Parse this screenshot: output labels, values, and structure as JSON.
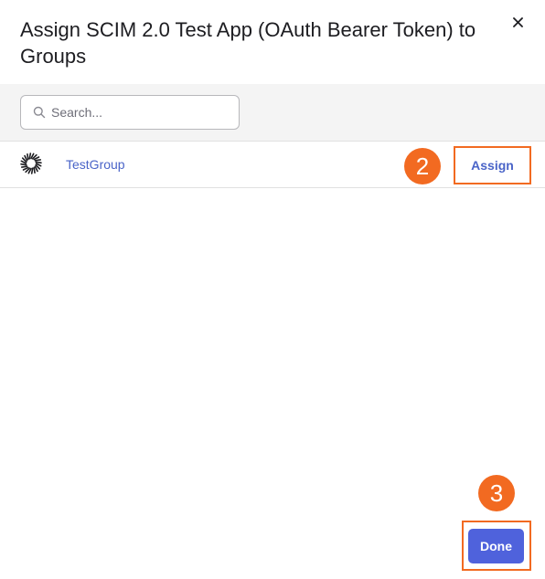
{
  "dialog": {
    "title": "Assign SCIM 2.0 Test App (OAuth Bearer Token) to Groups",
    "close_icon": "close-icon"
  },
  "search": {
    "placeholder": "Search...",
    "value": "",
    "icon": "search-icon"
  },
  "groups": [
    {
      "icon": "group-sunburst-icon",
      "name": "TestGroup",
      "action_label": "Assign"
    }
  ],
  "annotations": {
    "step_assign": "2",
    "step_done": "3",
    "color": "#f26a21"
  },
  "footer": {
    "done_label": "Done"
  },
  "colors": {
    "link": "#4a64c8",
    "primary": "#4f62dc",
    "search_bar_bg": "#f4f4f4"
  }
}
